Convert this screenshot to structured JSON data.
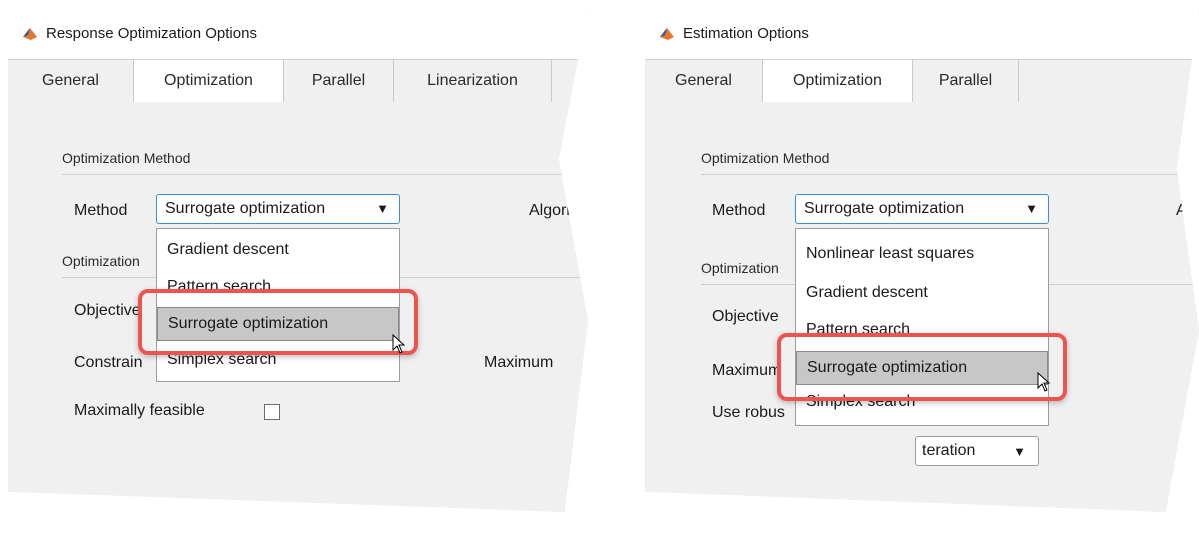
{
  "left": {
    "window_title": "Response Optimization Options",
    "tabs": [
      "General",
      "Optimization",
      "Parallel",
      "Linearization"
    ],
    "active_tab": "Optimization",
    "section_method": "Optimization Method",
    "method_label": "Method",
    "method_value": "Surrogate optimization",
    "algorithm_label_partial": "Algorithm",
    "section_options_partial": "Optimization",
    "objective_label_partial": "Objective",
    "constraint_label_partial": "Constrain",
    "maximum_label_partial": "Maximum",
    "maximally_feasible_label": "Maximally feasible",
    "dropdown_options": [
      "Gradient descent",
      "Pattern search",
      "Surrogate optimization",
      "Simplex search"
    ],
    "selected_option": "Surrogate optimization"
  },
  "right": {
    "window_title": "Estimation Options",
    "tabs": [
      "General",
      "Optimization",
      "Parallel"
    ],
    "active_tab": "Optimization",
    "section_method": "Optimization Method",
    "method_label": "Method",
    "method_value": "Surrogate optimization",
    "algorithm_label_partial": "A",
    "section_options_partial": "Optimization",
    "objective_label_partial": "Objective",
    "maximum_label_partial": "Maximum",
    "use_robust_label_partial": "Use robus",
    "bottom_combo_partial": "teration",
    "dropdown_options": [
      "Nonlinear least squares",
      "Gradient descent",
      "Pattern search",
      "Surrogate optimization",
      "Simplex search"
    ],
    "selected_option": "Surrogate optimization"
  },
  "colors": {
    "highlight": "#ef5350",
    "focus_border": "#3a8ed8",
    "selected_bg": "#c7c7c7"
  },
  "icons": {
    "app": "matlab-logo-icon",
    "dropdown_arrow": "triangle-down-icon",
    "cursor": "mouse-pointer-icon"
  }
}
